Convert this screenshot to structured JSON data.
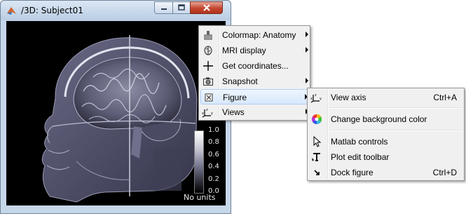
{
  "window": {
    "title": "/3D: Subject01",
    "controls": {
      "minimize": "minimize",
      "maximize": "maximize",
      "close": "close"
    }
  },
  "colorbar": {
    "ticks": [
      "1.0",
      "0.8",
      "0.6",
      "0.4",
      "0.2",
      "0.0"
    ],
    "units": "No units"
  },
  "context_menu": {
    "items": [
      {
        "label": "Colormap: Anatomy",
        "icon": "colormap-icon",
        "submenu": true
      },
      {
        "label": "MRI display",
        "icon": "mri-icon",
        "submenu": true
      },
      {
        "label": "Get coordinates...",
        "icon": "crosshair-icon",
        "submenu": false
      },
      {
        "label": "Snapshot",
        "icon": "camera-icon",
        "submenu": true
      },
      {
        "label": "Figure",
        "icon": "figure-icon",
        "submenu": true,
        "selected": true
      },
      {
        "label": "Views",
        "icon": "axes-icon",
        "submenu": true
      }
    ]
  },
  "figure_submenu": {
    "items": [
      {
        "label": "View axis",
        "shortcut": "Ctrl+A",
        "icon": "axes-icon"
      },
      {
        "label": "Change background color",
        "icon": "color-wheel-icon"
      },
      {
        "label": "Matlab controls",
        "icon": "pointer-icon"
      },
      {
        "label": "Plot edit toolbar",
        "icon": "text-edit-icon"
      },
      {
        "label": "Dock figure",
        "shortcut": "Ctrl+D",
        "icon": "dock-icon"
      }
    ]
  }
}
